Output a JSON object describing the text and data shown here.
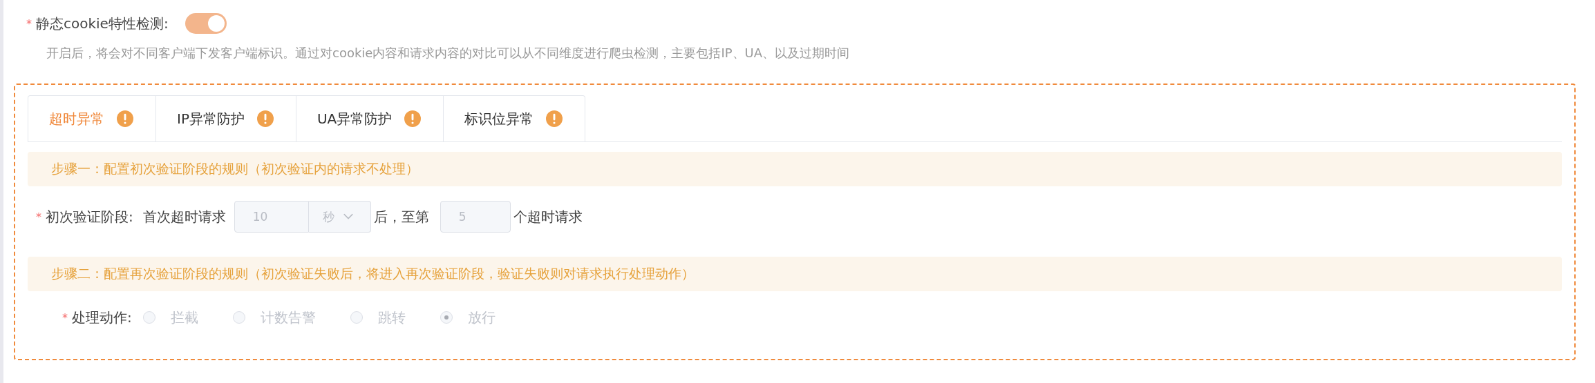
{
  "cookie_check": {
    "required_mark": "*",
    "label": "静态cookie特性检测:",
    "on": true,
    "description": "开启后，将会对不同客户端下发客户端标识。通过对cookie内容和请求内容的对比可以从不同维度进行爬虫检测，主要包括IP、UA、以及过期时间"
  },
  "tabs": [
    {
      "label": "超时异常",
      "selected": true,
      "warning": true
    },
    {
      "label": "IP异常防护",
      "selected": false,
      "warning": true
    },
    {
      "label": "UA异常防护",
      "selected": false,
      "warning": true
    },
    {
      "label": "标识位异常",
      "selected": false,
      "warning": true
    }
  ],
  "step1": {
    "title": "步骤一：配置初次验证阶段的规则（初次验证内的请求不处理）"
  },
  "initial_stage": {
    "required_mark": "*",
    "label": "初次验证阶段:",
    "prefix": "首次超时请求",
    "duration": {
      "value": "10",
      "disabled": true
    },
    "unit": {
      "value": "秒",
      "disabled": true
    },
    "middle": "后，至第",
    "count": {
      "value": "5",
      "disabled": true
    },
    "suffix": "个超时请求"
  },
  "step2": {
    "title": "步骤二：配置再次验证阶段的规则（初次验证失败后，将进入再次验证阶段，验证失败则对请求执行处理动作）"
  },
  "action": {
    "required_mark": "*",
    "label": "处理动作:",
    "disabled": true,
    "options": [
      {
        "label": "拦截",
        "selected": false
      },
      {
        "label": "计数告警",
        "selected": false
      },
      {
        "label": "跳转",
        "selected": false
      },
      {
        "label": "放行",
        "selected": true
      }
    ]
  }
}
